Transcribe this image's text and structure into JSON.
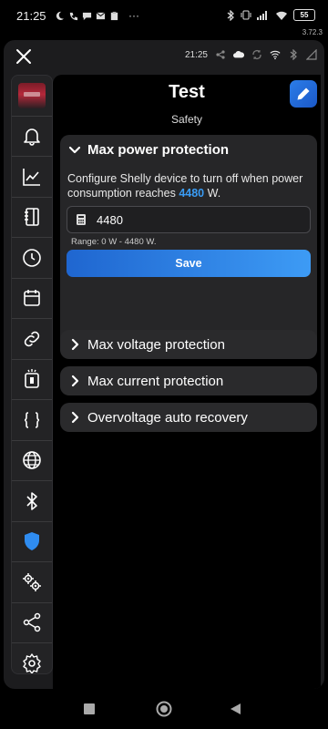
{
  "status_bar": {
    "time": "21:25",
    "overflow": "···",
    "battery": "55",
    "version": "3.72.3"
  },
  "app_bar": {
    "time": "21:25",
    "icons": [
      "share-icon",
      "cloud-icon",
      "sync-icon",
      "wifi-icon",
      "bluetooth-icon",
      "signal-icon"
    ]
  },
  "sidebar": {
    "items": [
      {
        "name": "device-thumbnail"
      },
      {
        "name": "bell-icon"
      },
      {
        "name": "chart-icon"
      },
      {
        "name": "notebook-icon"
      },
      {
        "name": "clock-icon"
      },
      {
        "name": "calendar-icon"
      },
      {
        "name": "link-icon"
      },
      {
        "name": "input-icon"
      },
      {
        "name": "code-braces-icon"
      },
      {
        "name": "globe-icon"
      },
      {
        "name": "bluetooth-icon"
      },
      {
        "name": "shield-icon",
        "active": true
      },
      {
        "name": "gears-icon"
      },
      {
        "name": "share-icon"
      },
      {
        "name": "settings-icon"
      }
    ]
  },
  "header": {
    "title": "Test",
    "subtitle": "Safety"
  },
  "sections": {
    "max_power": {
      "title": "Max power protection",
      "desc_prefix": "Configure Shelly device to turn off when power consumption reaches",
      "value": "4480",
      "unit": "W.",
      "input_value": "4480",
      "range": "Range: 0 W - 4480 W.",
      "save": "Save"
    },
    "max_voltage": {
      "title": "Max voltage protection"
    },
    "max_current": {
      "title": "Max current protection"
    },
    "overvoltage": {
      "title": "Overvoltage auto recovery"
    }
  },
  "colors": {
    "accent": "#2f87ef",
    "value_highlight": "#3a9cf5",
    "active_icon": "#2f8cf0"
  }
}
